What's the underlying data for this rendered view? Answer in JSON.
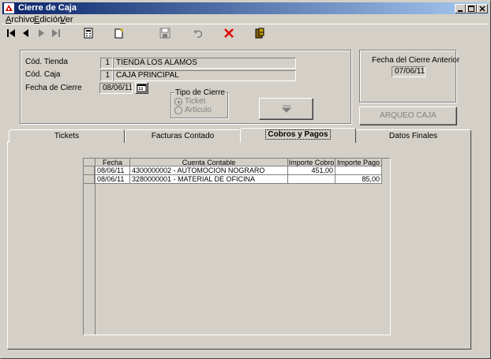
{
  "window": {
    "title": "Cierre de Caja"
  },
  "menu": [
    {
      "key": "A",
      "rest": "rchivo"
    },
    {
      "key": "E",
      "rest": "dición"
    },
    {
      "key": "V",
      "rest": "er"
    }
  ],
  "form": {
    "tienda_label": "Cód. Tienda",
    "tienda_code": "1",
    "tienda_name": "TIENDA LOS ALAMOS",
    "caja_label": "Cód. Caja",
    "caja_code": "1",
    "caja_name": "CAJA PRINCIPAL",
    "fecha_cierre_label": "Fecha de Cierre",
    "fecha_cierre": "08/06/11",
    "tipo_cierre_label": "Tipo de Cierre",
    "tipo_ticket": "Ticket",
    "tipo_articulo": "Artículo",
    "fecha_anterior_label": "Fecha del Cierre Anterior",
    "fecha_anterior": "07/06/11",
    "arqueo_label": "ARQUEO CAJA"
  },
  "tabs": [
    "Tickets",
    "Facturas Contado",
    "Cobros y Pagos",
    "Datos Finales"
  ],
  "active_tab": "Cobros y Pagos",
  "table": {
    "headers": [
      "Fecha",
      "Cuenta Contable",
      "Importe Cobro",
      "Importe Pago"
    ],
    "rows": [
      [
        "08/06/11",
        "4300000002 - AUTOMOCION NOGRARO",
        "451,00",
        ""
      ],
      [
        "08/06/11",
        "3280000001 - MATERIAL DE OFICINA",
        "",
        "85,00"
      ]
    ]
  },
  "colors": {
    "titlebar_start": "#0a246a",
    "titlebar_end": "#a6caf0",
    "face": "#d4d0c8",
    "delete_red": "#e00000"
  },
  "icons": [
    "app-icon",
    "minimize-icon",
    "maximize-icon",
    "close-icon",
    "first-record-icon",
    "prev-record-icon",
    "next-record-icon",
    "last-record-icon",
    "calculator-icon",
    "new-record-icon",
    "save-icon",
    "undo-icon",
    "delete-icon",
    "exit-icon",
    "calendar-icon",
    "arrow-down-icon"
  ]
}
